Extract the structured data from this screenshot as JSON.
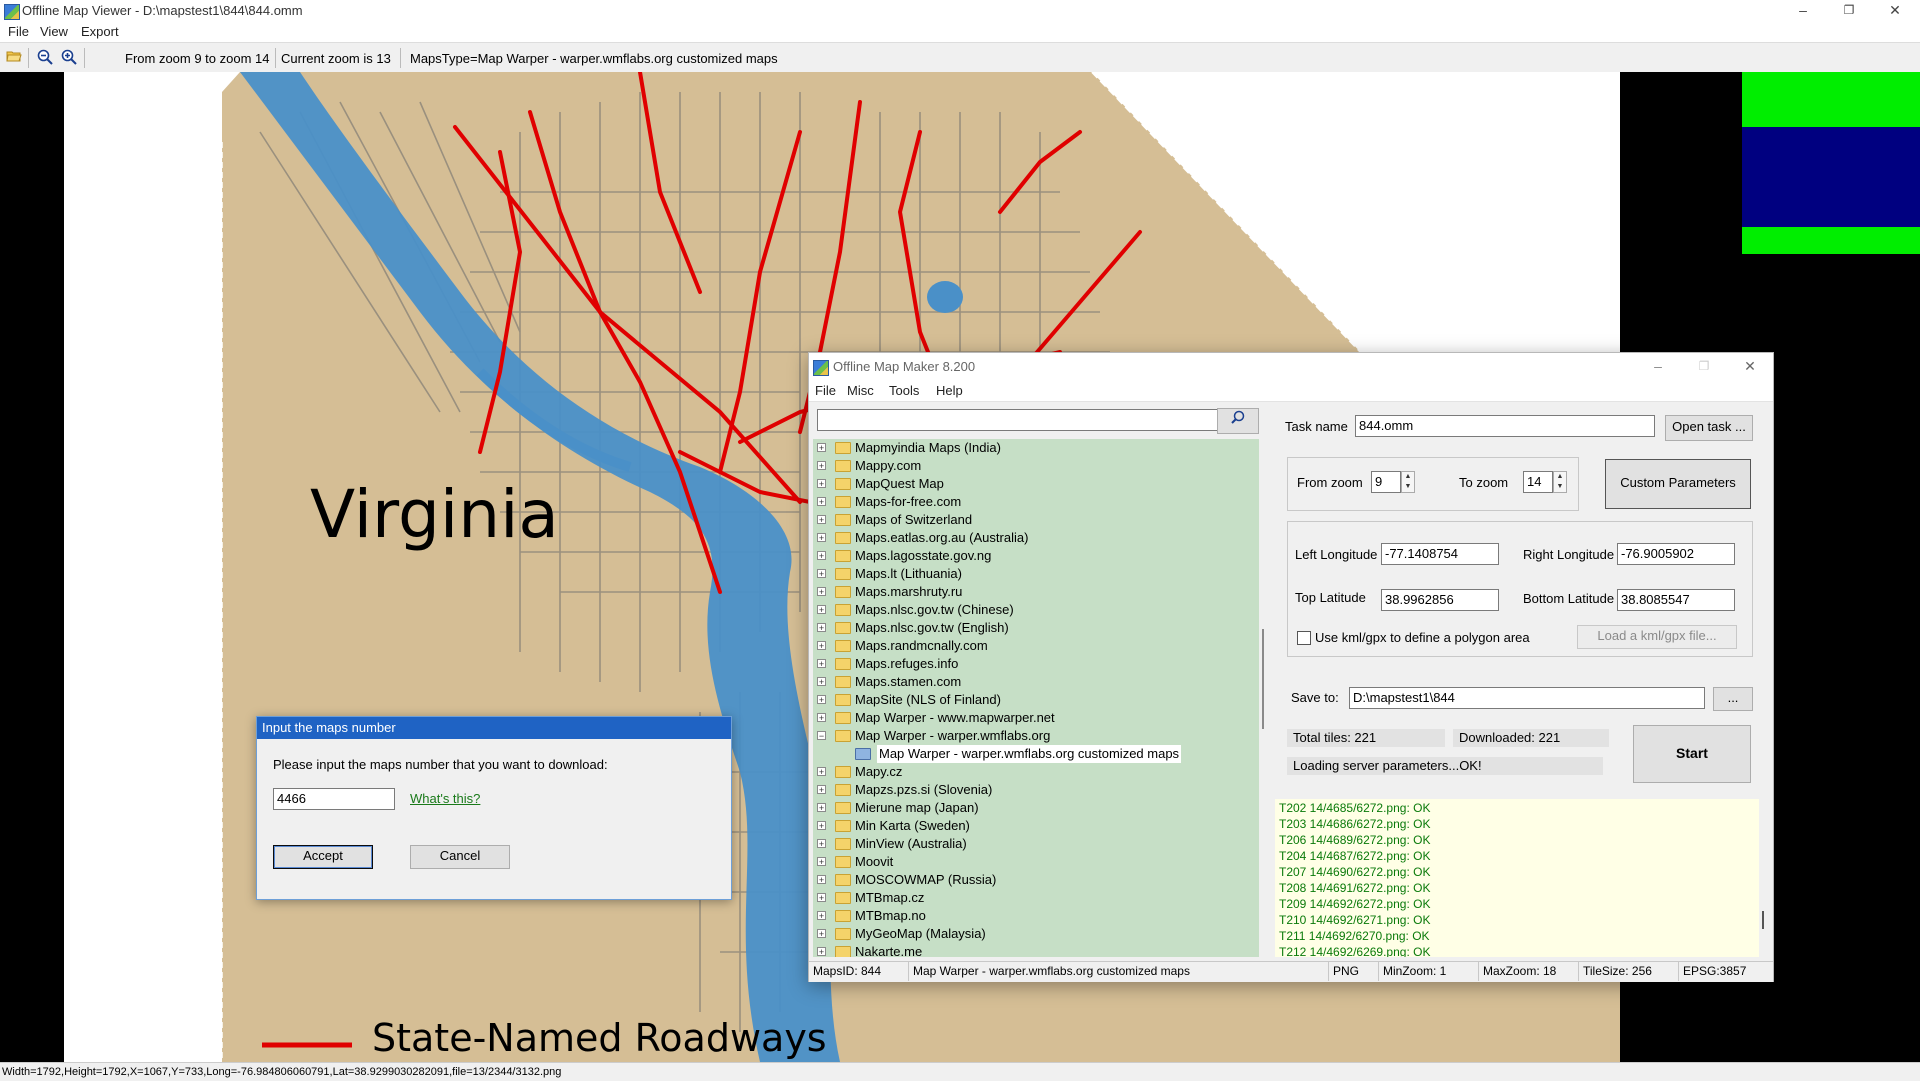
{
  "window": {
    "title": "Offline Map Viewer - D:\\mapstest1\\844\\844.omm",
    "controls": {
      "minimize": "–",
      "maximize": "❐",
      "close": "✕"
    }
  },
  "menu": [
    "File",
    "View",
    "Export"
  ],
  "toolbar": {
    "zoom_range": "From zoom 9 to zoom 14",
    "current_zoom": "Current zoom is 13",
    "maps_type": "MapsType=Map Warper - warper.wmflabs.org customized maps"
  },
  "map": {
    "state_label": "Virginia",
    "legend_label": "State-Named Roadways",
    "colors": {
      "land": "#d5be95",
      "roads_red": "#e00000",
      "water": "#4a90c8",
      "outside": "#000000",
      "overview_green": "#00ee00",
      "overview_navy": "#000080"
    }
  },
  "status_bar": "Width=1792,Height=1792,X=1067,Y=733,Long=-76.984806060791,Lat=38.9299030282091,file=13/2344/3132.png",
  "dialog": {
    "title": "Input the maps number",
    "prompt": "Please input the maps number that you want to download:",
    "value": "4466",
    "help_link": "What's this?",
    "accept": "Accept",
    "cancel": "Cancel"
  },
  "maker": {
    "title": "Offline Map Maker 8.200",
    "menu": [
      "File",
      "Misc",
      "Tools",
      "Help"
    ],
    "search_value": "",
    "tree": [
      {
        "label": "Mapmyindia Maps (India)"
      },
      {
        "label": "Mappy.com"
      },
      {
        "label": "MapQuest Map"
      },
      {
        "label": "Maps-for-free.com"
      },
      {
        "label": "Maps of Switzerland"
      },
      {
        "label": "Maps.eatlas.org.au (Australia)"
      },
      {
        "label": "Maps.lagosstate.gov.ng"
      },
      {
        "label": "Maps.lt (Lithuania)"
      },
      {
        "label": "Maps.marshruty.ru"
      },
      {
        "label": "Maps.nlsc.gov.tw (Chinese)"
      },
      {
        "label": "Maps.nlsc.gov.tw (English)"
      },
      {
        "label": "Maps.randmcnally.com"
      },
      {
        "label": "Maps.refuges.info"
      },
      {
        "label": "Maps.stamen.com"
      },
      {
        "label": "MapSite (NLS of Finland)"
      },
      {
        "label": "Map Warper - www.mapwarper.net"
      },
      {
        "label": "Map Warper - warper.wmflabs.org",
        "expanded": true
      },
      {
        "label": "Map Warper - warper.wmflabs.org customized maps",
        "child": true,
        "selected": true
      },
      {
        "label": "Mapy.cz"
      },
      {
        "label": "Mapzs.pzs.si (Slovenia)"
      },
      {
        "label": "Mierune map (Japan)"
      },
      {
        "label": "Min Karta (Sweden)"
      },
      {
        "label": "MinView (Australia)"
      },
      {
        "label": "Moovit"
      },
      {
        "label": "MOSCOWMAP (Russia)"
      },
      {
        "label": "MTBmap.cz"
      },
      {
        "label": "MTBmap.no"
      },
      {
        "label": "MyGeoMap (Malaysia)"
      },
      {
        "label": "Nakarte.me"
      }
    ],
    "task_name_label": "Task name",
    "task_name": "844.omm",
    "open_task": "Open task ...",
    "from_zoom_label": "From zoom",
    "from_zoom": "9",
    "to_zoom_label": "To zoom",
    "to_zoom": "14",
    "custom_params": "Custom Parameters",
    "left_lon_label": "Left Longitude",
    "left_lon": "-77.1408754",
    "right_lon_label": "Right Longitude",
    "right_lon": "-76.9005902",
    "top_lat_label": "Top Latitude",
    "top_lat": "38.9962856",
    "bottom_lat_label": "Bottom Latitude",
    "bottom_lat": "38.8085547",
    "kml_label": "Use kml/gpx to define a polygon area",
    "load_kml": "Load a kml/gpx file...",
    "save_to_label": "Save to:",
    "save_to": "D:\\mapstest1\\844",
    "browse": "...",
    "total_tiles": "Total tiles: 221",
    "downloaded": "Downloaded: 221",
    "loading": "Loading server parameters...OK!",
    "start": "Start",
    "log": [
      "T202 14/4685/6272.png: OK",
      "T203 14/4686/6272.png: OK",
      "T206 14/4689/6272.png: OK",
      "T204 14/4687/6272.png: OK",
      "T207 14/4690/6272.png: OK",
      "T208 14/4691/6272.png: OK",
      "T209 14/4692/6272.png: OK",
      "T210 14/4692/6271.png: OK",
      "T211 14/4692/6270.png: OK",
      "T212 14/4692/6269.png: OK"
    ],
    "status": {
      "maps_id": "MapsID: 844",
      "maps_name": "Map Warper - warper.wmflabs.org customized maps",
      "format": "PNG",
      "min_zoom": "MinZoom: 1",
      "max_zoom": "MaxZoom: 18",
      "tile_size": "TileSize: 256",
      "epsg": "EPSG:3857"
    }
  }
}
